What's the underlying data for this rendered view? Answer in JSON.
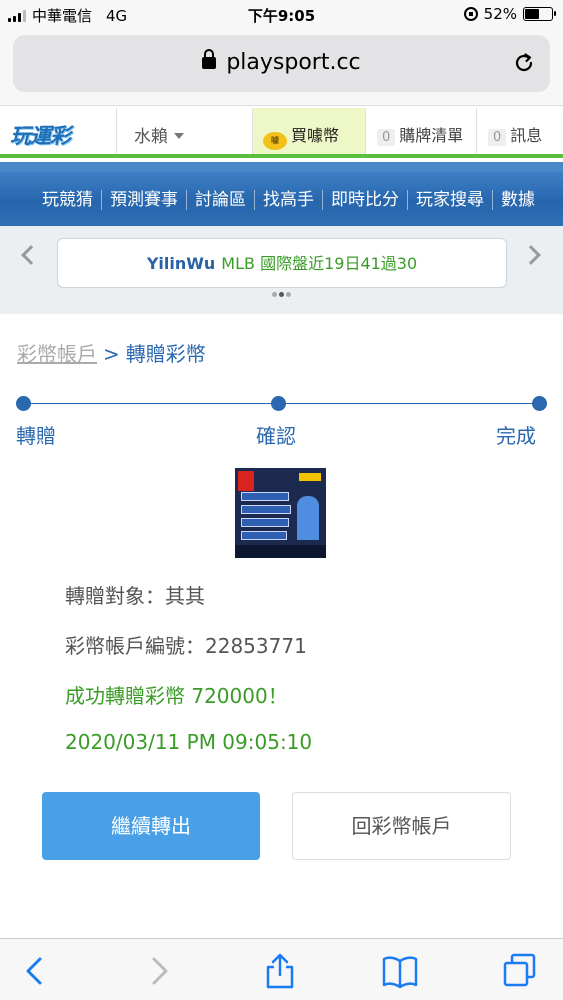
{
  "status_bar": {
    "carrier": "中華電信",
    "network": "4G",
    "time": "下午9:05",
    "battery_percent": "52%",
    "battery_level": 0.52
  },
  "browser": {
    "url": "playsport.cc",
    "lock_icon": "padlock-icon",
    "reload_icon": "reload-icon"
  },
  "header": {
    "logo": "玩運彩",
    "nickname": "水賴",
    "buy_coins": "買噱幣",
    "coin_icon_text": "噱",
    "cart_count": "0",
    "cart_label": "購牌清單",
    "msg_count": "0",
    "msg_label": "訊息",
    "accent_green": "#5bbf3d"
  },
  "nav": {
    "items": [
      "玩競猜",
      "預測賽事",
      "討論區",
      "找高手",
      "即時比分",
      "玩家搜尋",
      "數據"
    ]
  },
  "ticker": {
    "user": "YilinWu",
    "record": "MLB 國際盤近19日41過30"
  },
  "breadcrumb": {
    "link": "彩幣帳戶",
    "separator": ">",
    "current": "轉贈彩幣"
  },
  "steps": [
    "轉贈",
    "確認",
    "完成"
  ],
  "details": {
    "recipient": "轉贈對象：其其",
    "account_no": "彩幣帳戶編號：22853771",
    "success": "成功轉贈彩幣 720000！",
    "timestamp": "2020/03/11 PM 09:05:10"
  },
  "buttons": {
    "continue": "繼續轉出",
    "back_to_account": "回彩幣帳戶"
  },
  "colors": {
    "brand_blue": "#2a68b0",
    "button_blue": "#4aa0e6",
    "success_green": "#3a9c26"
  }
}
